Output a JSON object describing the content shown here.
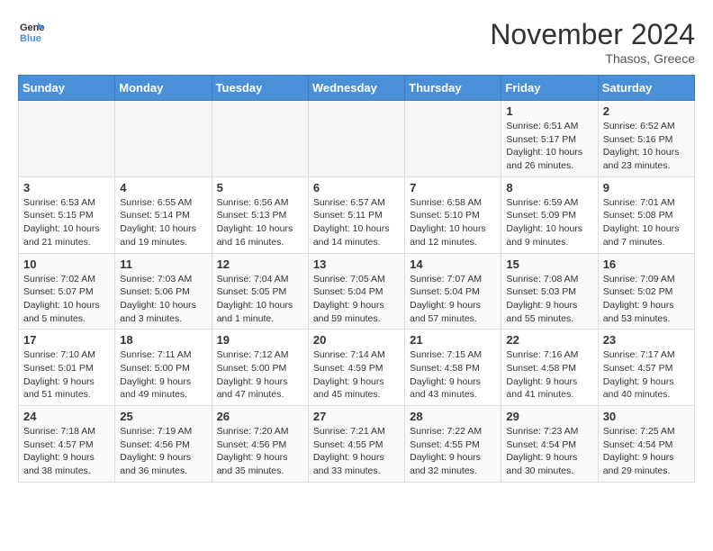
{
  "header": {
    "logo_general": "General",
    "logo_blue": "Blue",
    "month_title": "November 2024",
    "location": "Thasos, Greece"
  },
  "weekdays": [
    "Sunday",
    "Monday",
    "Tuesday",
    "Wednesday",
    "Thursday",
    "Friday",
    "Saturday"
  ],
  "weeks": [
    [
      {
        "day": "",
        "info": ""
      },
      {
        "day": "",
        "info": ""
      },
      {
        "day": "",
        "info": ""
      },
      {
        "day": "",
        "info": ""
      },
      {
        "day": "",
        "info": ""
      },
      {
        "day": "1",
        "info": "Sunrise: 6:51 AM\nSunset: 5:17 PM\nDaylight: 10 hours and 26 minutes."
      },
      {
        "day": "2",
        "info": "Sunrise: 6:52 AM\nSunset: 5:16 PM\nDaylight: 10 hours and 23 minutes."
      }
    ],
    [
      {
        "day": "3",
        "info": "Sunrise: 6:53 AM\nSunset: 5:15 PM\nDaylight: 10 hours and 21 minutes."
      },
      {
        "day": "4",
        "info": "Sunrise: 6:55 AM\nSunset: 5:14 PM\nDaylight: 10 hours and 19 minutes."
      },
      {
        "day": "5",
        "info": "Sunrise: 6:56 AM\nSunset: 5:13 PM\nDaylight: 10 hours and 16 minutes."
      },
      {
        "day": "6",
        "info": "Sunrise: 6:57 AM\nSunset: 5:11 PM\nDaylight: 10 hours and 14 minutes."
      },
      {
        "day": "7",
        "info": "Sunrise: 6:58 AM\nSunset: 5:10 PM\nDaylight: 10 hours and 12 minutes."
      },
      {
        "day": "8",
        "info": "Sunrise: 6:59 AM\nSunset: 5:09 PM\nDaylight: 10 hours and 9 minutes."
      },
      {
        "day": "9",
        "info": "Sunrise: 7:01 AM\nSunset: 5:08 PM\nDaylight: 10 hours and 7 minutes."
      }
    ],
    [
      {
        "day": "10",
        "info": "Sunrise: 7:02 AM\nSunset: 5:07 PM\nDaylight: 10 hours and 5 minutes."
      },
      {
        "day": "11",
        "info": "Sunrise: 7:03 AM\nSunset: 5:06 PM\nDaylight: 10 hours and 3 minutes."
      },
      {
        "day": "12",
        "info": "Sunrise: 7:04 AM\nSunset: 5:05 PM\nDaylight: 10 hours and 1 minute."
      },
      {
        "day": "13",
        "info": "Sunrise: 7:05 AM\nSunset: 5:04 PM\nDaylight: 9 hours and 59 minutes."
      },
      {
        "day": "14",
        "info": "Sunrise: 7:07 AM\nSunset: 5:04 PM\nDaylight: 9 hours and 57 minutes."
      },
      {
        "day": "15",
        "info": "Sunrise: 7:08 AM\nSunset: 5:03 PM\nDaylight: 9 hours and 55 minutes."
      },
      {
        "day": "16",
        "info": "Sunrise: 7:09 AM\nSunset: 5:02 PM\nDaylight: 9 hours and 53 minutes."
      }
    ],
    [
      {
        "day": "17",
        "info": "Sunrise: 7:10 AM\nSunset: 5:01 PM\nDaylight: 9 hours and 51 minutes."
      },
      {
        "day": "18",
        "info": "Sunrise: 7:11 AM\nSunset: 5:00 PM\nDaylight: 9 hours and 49 minutes."
      },
      {
        "day": "19",
        "info": "Sunrise: 7:12 AM\nSunset: 5:00 PM\nDaylight: 9 hours and 47 minutes."
      },
      {
        "day": "20",
        "info": "Sunrise: 7:14 AM\nSunset: 4:59 PM\nDaylight: 9 hours and 45 minutes."
      },
      {
        "day": "21",
        "info": "Sunrise: 7:15 AM\nSunset: 4:58 PM\nDaylight: 9 hours and 43 minutes."
      },
      {
        "day": "22",
        "info": "Sunrise: 7:16 AM\nSunset: 4:58 PM\nDaylight: 9 hours and 41 minutes."
      },
      {
        "day": "23",
        "info": "Sunrise: 7:17 AM\nSunset: 4:57 PM\nDaylight: 9 hours and 40 minutes."
      }
    ],
    [
      {
        "day": "24",
        "info": "Sunrise: 7:18 AM\nSunset: 4:57 PM\nDaylight: 9 hours and 38 minutes."
      },
      {
        "day": "25",
        "info": "Sunrise: 7:19 AM\nSunset: 4:56 PM\nDaylight: 9 hours and 36 minutes."
      },
      {
        "day": "26",
        "info": "Sunrise: 7:20 AM\nSunset: 4:56 PM\nDaylight: 9 hours and 35 minutes."
      },
      {
        "day": "27",
        "info": "Sunrise: 7:21 AM\nSunset: 4:55 PM\nDaylight: 9 hours and 33 minutes."
      },
      {
        "day": "28",
        "info": "Sunrise: 7:22 AM\nSunset: 4:55 PM\nDaylight: 9 hours and 32 minutes."
      },
      {
        "day": "29",
        "info": "Sunrise: 7:23 AM\nSunset: 4:54 PM\nDaylight: 9 hours and 30 minutes."
      },
      {
        "day": "30",
        "info": "Sunrise: 7:25 AM\nSunset: 4:54 PM\nDaylight: 9 hours and 29 minutes."
      }
    ]
  ]
}
